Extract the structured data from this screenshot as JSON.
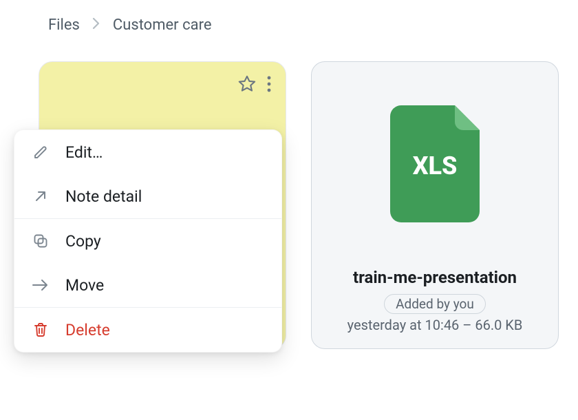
{
  "breadcrumb": {
    "root": "Files",
    "current": "Customer care"
  },
  "note": {
    "title_hidden": ""
  },
  "file": {
    "ext_badge": "XLS",
    "name": "train-me-presentation",
    "added_by": "Added by you",
    "meta": "yesterday at 10:46 – 66.0 KB"
  },
  "menu": {
    "edit": "Edit…",
    "detail": "Note detail",
    "copy": "Copy",
    "move": "Move",
    "delete": "Delete"
  }
}
